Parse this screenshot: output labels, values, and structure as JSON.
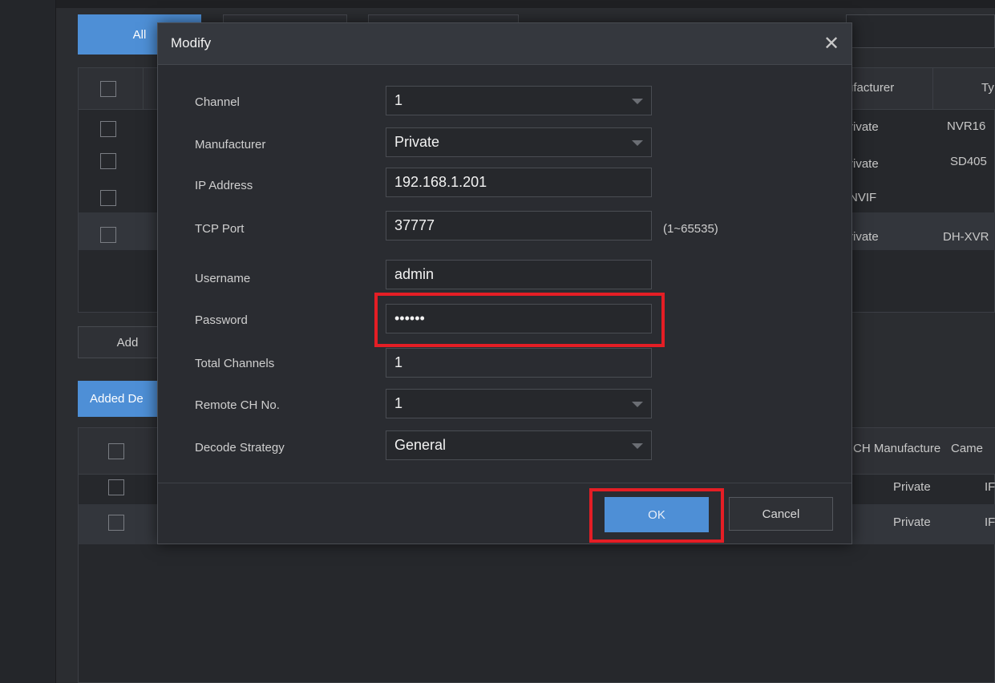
{
  "background": {
    "filter_buttons": {
      "all": "All"
    },
    "top_table": {
      "headers": [
        "ufacturer",
        "Ty"
      ],
      "rows": [
        {
          "manufacturer": "rivate",
          "type": "NVR16"
        },
        {
          "manufacturer": "rivate",
          "type": "SD405"
        },
        {
          "manufacturer": "NVIF",
          "type": ""
        },
        {
          "manufacturer": "rivate",
          "type": "DH-XVR"
        }
      ]
    },
    "add_button": "Add",
    "added_devices_tab": "Added De",
    "bottom_table": {
      "headers": [
        "CH Manufacture",
        "Came"
      ],
      "rows": [
        {
          "manufacturer": "Private",
          "camera": "IF"
        },
        {
          "manufacturer": "Private",
          "camera": "IF"
        }
      ]
    }
  },
  "modal": {
    "title": "Modify",
    "fields": {
      "channel": {
        "label": "Channel",
        "value": "1"
      },
      "manufacturer": {
        "label": "Manufacturer",
        "value": "Private"
      },
      "ip_address": {
        "label": "IP Address",
        "value": "192.168.1.201"
      },
      "tcp_port": {
        "label": "TCP Port",
        "value": "37777",
        "hint": "(1~65535)"
      },
      "username": {
        "label": "Username",
        "value": "admin"
      },
      "password": {
        "label": "Password",
        "value": "••••••"
      },
      "total_channels": {
        "label": "Total Channels",
        "value": "1"
      },
      "remote_ch": {
        "label": "Remote CH No.",
        "value": "1"
      },
      "decode_strategy": {
        "label": "Decode Strategy",
        "value": "General"
      }
    },
    "ok_label": "OK",
    "cancel_label": "Cancel"
  },
  "colors": {
    "accent": "#4e8fd6",
    "highlight": "#e41e25",
    "background": "#2b2d31"
  },
  "icons": {
    "close": "close-icon",
    "dropdown": "chevron-down-icon"
  }
}
